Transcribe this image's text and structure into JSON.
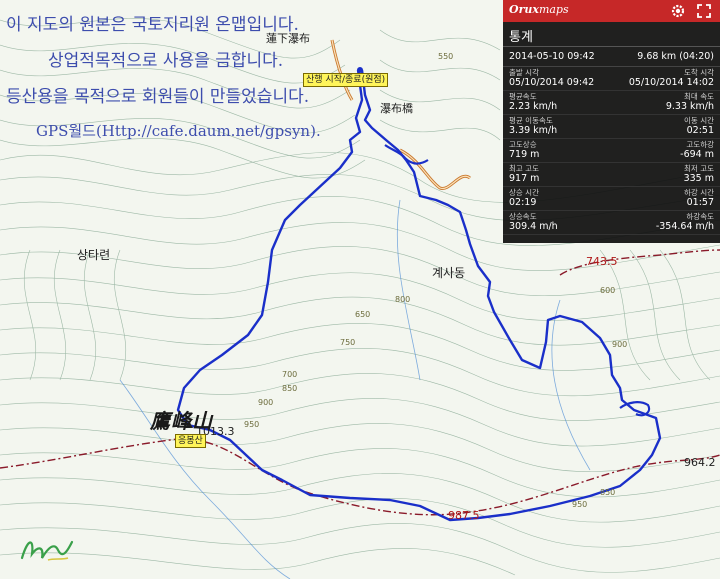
{
  "watermark": {
    "line1": "이 지도의 원본은 국토지리원 온맵입니다.",
    "line2": "상업적목적으로 사용을 금합니다.",
    "line3": "등산용을 목적으로 회원들이 만들었습니다.",
    "line4": "GPS월드(Http://cafe.daum.net/gpsyn)."
  },
  "map": {
    "start_tag": "산행 시작/종료(원점)",
    "waterfall": "瀑布橋",
    "lotus_waterfall": "蓮下瀑布",
    "village_west": "상타련",
    "village_east": "계사동",
    "peak_hanja": "鷹峰山",
    "peak_tag": "응봉산",
    "peak_elev": "1013.3",
    "elev_743": "743.5",
    "elev_964": "964.2",
    "elev_987": "987.5",
    "contour_labels": [
      "550",
      "650",
      "700",
      "750",
      "800",
      "850",
      "900",
      "950",
      "600",
      "900",
      "950",
      "850"
    ]
  },
  "panel": {
    "logo_prefix": "Orux",
    "logo_suffix": "maps",
    "gear_icon": "gear-icon",
    "expand_icon": "expand-icon",
    "title": "통계",
    "summary_left": "2014-05-10 09:42",
    "summary_right": "9.68 km (04:20)",
    "stats": [
      {
        "l_label": "출발 시각",
        "l_value": "05/10/2014 09:42",
        "r_label": "도착 시각",
        "r_value": "05/10/2014 14:02"
      },
      {
        "l_label": "평균속도",
        "l_value": "2.23 km/h",
        "r_label": "최대 속도",
        "r_value": "9.33 km/h"
      },
      {
        "l_label": "평균 이동속도",
        "l_value": "3.39 km/h",
        "r_label": "이동 시간",
        "r_value": "02:51"
      },
      {
        "l_label": "고도상승",
        "l_value": "719 m",
        "r_label": "고도하강",
        "r_value": "-694 m"
      },
      {
        "l_label": "최고 고도",
        "l_value": "917 m",
        "r_label": "최저 고도",
        "r_value": "335 m"
      },
      {
        "l_label": "상승 시간",
        "l_value": "02:19",
        "r_label": "하강 시간",
        "r_value": "01:57"
      },
      {
        "l_label": "상승속도",
        "l_value": "309.4 m/h",
        "r_label": "하강속도",
        "r_value": "-354.64 m/h"
      }
    ]
  },
  "colors": {
    "track": "#1a2fc9",
    "contour": "#8fae9a",
    "road": "#c9782e",
    "boundary": "#8a1a2a",
    "panel_bar": "#c62828"
  }
}
